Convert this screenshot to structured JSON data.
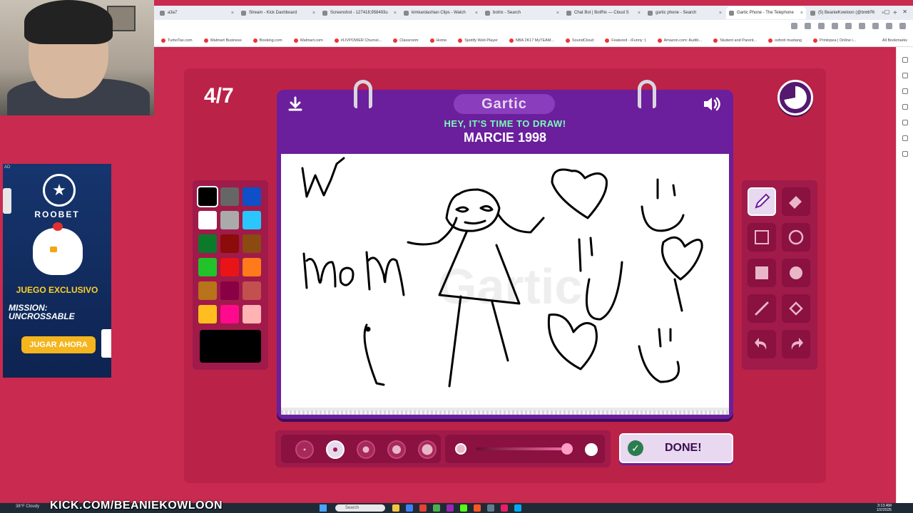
{
  "browser": {
    "tabs": [
      {
        "label": "a3a7",
        "active": false
      },
      {
        "label": "Stream - Kick Dashboard",
        "active": false
      },
      {
        "label": "Screenshot - 127418;958493u",
        "active": false
      },
      {
        "label": "kimkardashian Clips - Watch",
        "active": false
      },
      {
        "label": "botrix - Search",
        "active": false
      },
      {
        "label": "Chat Bot | BotRix — Cloud S",
        "active": false
      },
      {
        "label": "gartic phone - Search",
        "active": false
      },
      {
        "label": "Gartic Phone - The Telephone",
        "active": true
      },
      {
        "label": "(5) BeanieKowloon (@bro176",
        "active": false
      }
    ],
    "new_tab": "+",
    "bookmarks": [
      "TurboTax.com",
      "Walmart Business",
      "Booking.com",
      "Walmart.com",
      "#LIVPOWER Churnei...",
      "Classroom",
      "Home",
      "Spotify Web Player",
      "NBA 2K17 MyTEAM...",
      "SoundCloud",
      "Featured - iFunny :)",
      "Amazon.com: Audib...",
      "Student and Parent...",
      "oxford mustang",
      "Printopea | Online i..."
    ],
    "all_bookmarks": "All Bookmarks"
  },
  "ad": {
    "tag": "AD",
    "brand": "ROOBET",
    "headline": "JUEGO EXCLUSIVO",
    "title": "MISSION: UNCROSSABLE",
    "cta": "JUGAR AHORA"
  },
  "game": {
    "round": "4/7",
    "logo": "Gartic",
    "subtitle": "HEY, IT'S TIME TO DRAW!",
    "prompt": "MARCIE 1998",
    "done_label": "DONE!",
    "palette": [
      "#000000",
      "#666666",
      "#0f50c8",
      "#ffffff",
      "#aaaaaa",
      "#2ac7ff",
      "#0b7a2b",
      "#8c0b0b",
      "#8a4a12",
      "#22c22b",
      "#e81417",
      "#ff7a1a",
      "#b8731b",
      "#8a0044",
      "#c2504f",
      "#ffbd1f",
      "#ff0a8c",
      "#ffb3b3"
    ],
    "selected_color": "#000000",
    "tools": [
      "pen-icon",
      "eraser-icon",
      "rectangle-outline-icon",
      "circle-outline-icon",
      "rectangle-filled-icon",
      "circle-filled-icon",
      "line-icon",
      "fill-bucket-icon",
      "undo-icon",
      "redo-icon"
    ],
    "selected_tool": "pen-icon",
    "brush_sizes": 5,
    "selected_size_index": 1,
    "opacity_fraction": 0.85,
    "timer_remaining_fraction": 0.72
  },
  "overlay": {
    "stream_url": "KICK.COM/BEANIEKOWLOON"
  },
  "taskbar": {
    "weather": "38°F Cloudy",
    "search": "Search",
    "time": "3:13 AM",
    "date": "1/2/2025"
  }
}
